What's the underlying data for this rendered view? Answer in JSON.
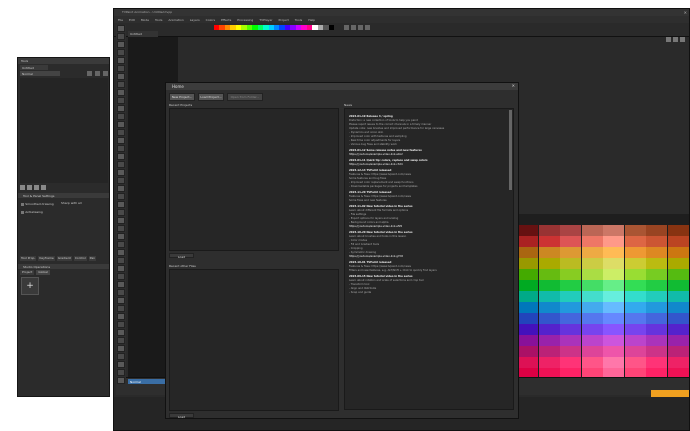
{
  "main_window": {
    "title": "TVPaint Animation - Untitled.tvpp",
    "menu": [
      "File",
      "Edit",
      "Mode",
      "Tools",
      "Animation",
      "Layers",
      "Colors",
      "Effects",
      "Processing",
      "TVPlayer",
      "Project",
      "Tools",
      "Help"
    ],
    "canvas_tab": "Untitled"
  },
  "left_window": {
    "title": "Tools",
    "tab_label": "Untitled",
    "mode_label": "Normal",
    "section_title": "Tool & Panel Settings",
    "options": [
      "Smoothed drawing",
      "Antialiasing"
    ],
    "option_value": "Sharp with all",
    "tabs": [
      "Tool Prop.",
      "Keyframe",
      "Gradient",
      "Control",
      "Pan"
    ],
    "bottom_title": "Studio Operations",
    "bottom_tabs": [
      "Project",
      "Global"
    ],
    "add_symbol": "+"
  },
  "home": {
    "title": "Home",
    "buttons": [
      "New Project...",
      "Load Project...",
      "Open from Folder..."
    ],
    "recent_projects_label": "Recent Projects",
    "recent_files_label": "Recent other Files",
    "load_label": "Load",
    "news_label": "News",
    "news": [
      {
        "type": "h",
        "text": "2024-01-19 Release 4 / spring"
      },
      {
        "type": "t",
        "text": "Distortion: a new collection of tools to help you paint"
      },
      {
        "type": "t",
        "text": "Please report issues to the correct channels in a timely manner"
      },
      {
        "type": "t",
        "text": "Update note: new brushes and improved performance for large canvases"
      },
      {
        "type": "t",
        "text": "- Dynamics and onion skin"
      },
      {
        "type": "t",
        "text": "- Improved color with textures and sampling"
      },
      {
        "type": "t",
        "text": "- Real time color adjustments for layers"
      },
      {
        "type": "t",
        "text": "- Various bug fixes and stability work"
      },
      {
        "type": "h",
        "text": "2024-01-12 Some release notes and new features"
      },
      {
        "type": "l",
        "text": "https://youtu.be/example-video-link-a1b2"
      },
      {
        "type": "h",
        "text": "2024-01-11 Quick tip: colors, replace and swap colors"
      },
      {
        "type": "l",
        "text": "https://youtu.be/example-video-link-c3d4"
      },
      {
        "type": "h",
        "text": "2023-12-14 TVPaint released"
      },
      {
        "type": "t",
        "text": "Features & fixes: https://www.tvpaint.com/news"
      },
      {
        "type": "t",
        "text": "Some features and bug fixes"
      },
      {
        "type": "t",
        "text": "- Improved color replacement and swap functions"
      },
      {
        "type": "t",
        "text": "- Downloadable packages for projects and templates"
      },
      {
        "type": "h",
        "text": "2023-11-20 TVPaint released"
      },
      {
        "type": "t",
        "text": "Features & fixes: https://www.tvpaint.com/news"
      },
      {
        "type": "t",
        "text": "Some fixes and new features"
      },
      {
        "type": "h",
        "text": "2023-11-02 New tutorial video in the series"
      },
      {
        "type": "t",
        "text": "Learn about different file formats and options"
      },
      {
        "type": "t",
        "text": "- File settings"
      },
      {
        "type": "t",
        "text": "- Export options for layers and scaling"
      },
      {
        "type": "t",
        "text": "- Background colors and alpha"
      },
      {
        "type": "l",
        "text": "https://youtu.be/example-video-link-e5f6"
      },
      {
        "type": "h",
        "text": "2023-10-20 New tutorial video in the series"
      },
      {
        "type": "t",
        "text": "Learn about brushes and tools in this lesson"
      },
      {
        "type": "t",
        "text": "- Color modes"
      },
      {
        "type": "t",
        "text": "- Fill and Gradient tools"
      },
      {
        "type": "t",
        "text": "- Cropping"
      },
      {
        "type": "t",
        "text": "- Symmetric drawing"
      },
      {
        "type": "l",
        "text": "https://youtu.be/example-video-link-g7h8"
      },
      {
        "type": "h",
        "text": "2023-10-01 TVPaint released"
      },
      {
        "type": "t",
        "text": "Features & fixes: https://www.tvpaint.com/news"
      },
      {
        "type": "t",
        "text": "Filters and new features, e.g. ALT/Shift + Click to quickly find layers"
      },
      {
        "type": "h",
        "text": "2023-09-15 New tutorial video in the series"
      },
      {
        "type": "t",
        "text": "Learn about rotation and scale of selections and crop tool"
      },
      {
        "type": "t",
        "text": "- Transform tool"
      },
      {
        "type": "t",
        "text": "- Align and distribute"
      },
      {
        "type": "t",
        "text": "- Snap and guide"
      }
    ]
  },
  "colors": {
    "window_bg": "#2b2b2b",
    "dark_bg": "#1e1e1e",
    "accent": "#f0a020",
    "palette": [
      [
        "#661111",
        "#993333",
        "#aa4444",
        "#bb6655",
        "#cc7766",
        "#aa5533",
        "#994422",
        "#883311"
      ],
      [
        "#aa2222",
        "#cc3333",
        "#dd5555",
        "#ee7766",
        "#ff9988",
        "#dd6644",
        "#cc5533",
        "#bb4422"
      ],
      [
        "#aa6611",
        "#cc8822",
        "#dd9933",
        "#eeaa44",
        "#ffbb55",
        "#ee9933",
        "#dd8822",
        "#cc7711"
      ],
      [
        "#999900",
        "#aaaa00",
        "#bbbb22",
        "#cccc44",
        "#dddd66",
        "#cccc33",
        "#bbbb11",
        "#aaaa00"
      ],
      [
        "#44aa00",
        "#66bb11",
        "#88cc22",
        "#aadd44",
        "#ccee66",
        "#99dd33",
        "#77cc22",
        "#55bb11"
      ],
      [
        "#00aa22",
        "#11bb33",
        "#22cc44",
        "#44dd66",
        "#66ee88",
        "#33dd55",
        "#22cc44",
        "#11bb33"
      ],
      [
        "#00aa88",
        "#11bbaa",
        "#22ccbb",
        "#44ddcc",
        "#66eedd",
        "#33ddcc",
        "#22ccbb",
        "#11bbaa"
      ],
      [
        "#0077bb",
        "#1188cc",
        "#2299dd",
        "#44aaee",
        "#66bbff",
        "#33aaee",
        "#2299dd",
        "#1188cc"
      ],
      [
        "#2244bb",
        "#3355cc",
        "#4466dd",
        "#5577ee",
        "#6688ff",
        "#5577ee",
        "#4466dd",
        "#3355cc"
      ],
      [
        "#4411bb",
        "#5522cc",
        "#6633dd",
        "#7744ee",
        "#8855ff",
        "#7744ee",
        "#6633dd",
        "#5522cc"
      ],
      [
        "#881199",
        "#9922aa",
        "#aa33bb",
        "#bb44cc",
        "#cc55dd",
        "#bb44cc",
        "#aa33bb",
        "#9922aa"
      ],
      [
        "#aa1166",
        "#bb2277",
        "#cc3388",
        "#dd4499",
        "#ee55aa",
        "#dd4499",
        "#cc3388",
        "#bb2277"
      ],
      [
        "#dd1155",
        "#ee2266",
        "#ff3377",
        "#ff5588",
        "#ff77aa",
        "#ff5588",
        "#ff3377",
        "#ee2266"
      ],
      [
        "#dd0044",
        "#ee1155",
        "#ff2266",
        "#ff4477",
        "#ff6699",
        "#ff4477",
        "#ff2266",
        "#ee1155"
      ]
    ],
    "top_strip": [
      "#ff0000",
      "#ff4400",
      "#ff8800",
      "#ffcc00",
      "#ffff00",
      "#aaff00",
      "#55ff00",
      "#00ff00",
      "#00ff66",
      "#00ffcc",
      "#00ccff",
      "#0088ff",
      "#0044ff",
      "#4400ff",
      "#8800ff",
      "#cc00ff",
      "#ff00cc",
      "#ff0088",
      "#ffffff",
      "#aaaaaa",
      "#555555",
      "#000000"
    ]
  },
  "timeline": {
    "layer_label": "Normal"
  }
}
